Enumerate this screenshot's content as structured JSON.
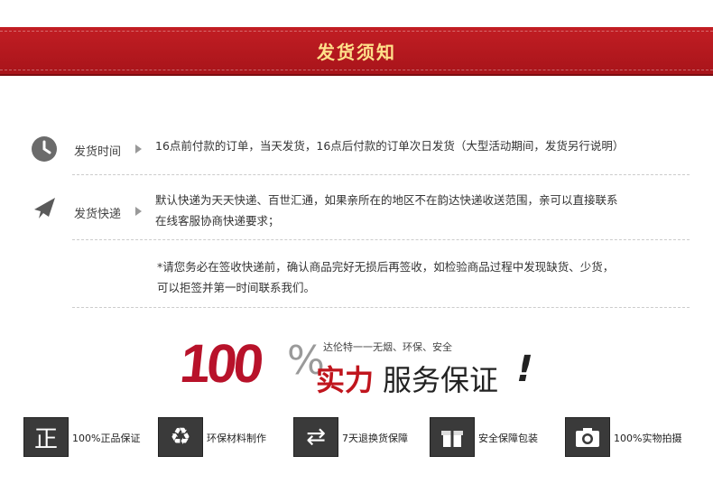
{
  "header": {
    "title": "发货须知"
  },
  "shipping_time": {
    "label": "发货时间",
    "text": "16点前付款的订单，当天发货，16点后付款的订单次日发货（大型活动期间，发货另行说明）"
  },
  "shipping_courier": {
    "label": "发货快递",
    "text_line1": "默认快递为天天快递、百世汇通，如果亲所在的地区不在韵达快递收送范围，亲可以直接联系",
    "text_line2": "在线客服协商快递要求；"
  },
  "notice": {
    "line1": "*请您务必在签收快递前，确认商品完好无损后再签收，如检验商品过程中发现缺货、少货，",
    "line2": "可以拒签并第一时间联系我们。"
  },
  "guarantee": {
    "number": "100",
    "percent": "%",
    "subtitle": "达伦特一一无烟、环保、安全",
    "power": "实力",
    "service": "服务保证",
    "exclaim": "!"
  },
  "badges": [
    {
      "label": "100%正品保证",
      "icon": "authentic-icon",
      "glyph": "正"
    },
    {
      "label": "环保材料制作",
      "icon": "recycle-icon",
      "glyph": "♻"
    },
    {
      "label": "7天退换货保障",
      "icon": "exchange-icon",
      "glyph": "⇄"
    },
    {
      "label": "安全保障包装",
      "icon": "gift-icon",
      "glyph": "🎁"
    },
    {
      "label": "100%实物拍摄",
      "icon": "camera-icon",
      "glyph": "📷"
    }
  ]
}
